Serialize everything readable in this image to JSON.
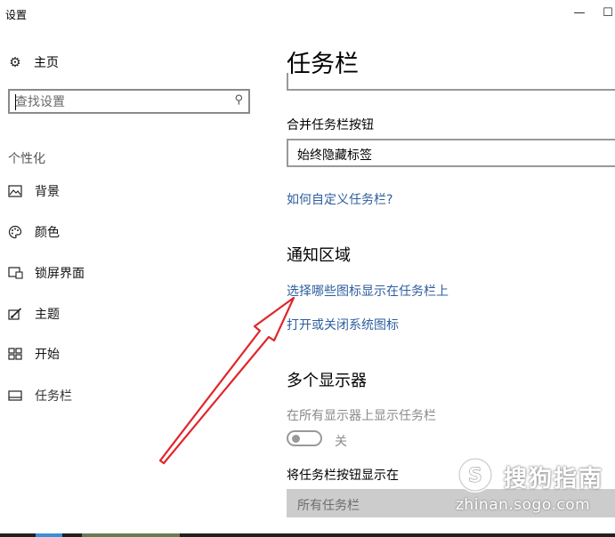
{
  "window": {
    "title": "设置",
    "minimize_glyph": "—",
    "maximize_glyph": "☐"
  },
  "sidebar": {
    "home_label": "主页",
    "search": {
      "placeholder": "查找设置",
      "value": ""
    },
    "section_label": "个性化",
    "items": [
      {
        "label": "背景",
        "icon": "picture-icon"
      },
      {
        "label": "颜色",
        "icon": "palette-icon"
      },
      {
        "label": "锁屏界面",
        "icon": "lock-screen-icon"
      },
      {
        "label": "主题",
        "icon": "theme-brush-icon"
      },
      {
        "label": "开始",
        "icon": "start-grid-icon"
      },
      {
        "label": "任务栏",
        "icon": "taskbar-icon",
        "selected": true
      }
    ]
  },
  "main": {
    "title": "任务栏",
    "combine_label": "合并任务栏按钮",
    "combine_value": "始终隐藏标签",
    "customize_link": "如何自定义任务栏?",
    "notification_heading": "通知区域",
    "select_icons_link": "选择哪些图标显示在任务栏上",
    "system_icons_link": "打开或关闭系统图标",
    "multi_display_heading": "多个显示器",
    "show_all_displays_label": "在所有显示器上显示任务栏",
    "toggle_state": "关",
    "show_buttons_on_label": "将任务栏按钮显示在",
    "show_buttons_on_value": "所有任务栏"
  },
  "watermark": {
    "brand": "搜狗指南",
    "url": "zhinan.sogo.com"
  },
  "colors": {
    "link": "#2d5e9e",
    "annotation_arrow": "#e0262b",
    "disabled_fill": "#cccccc"
  }
}
